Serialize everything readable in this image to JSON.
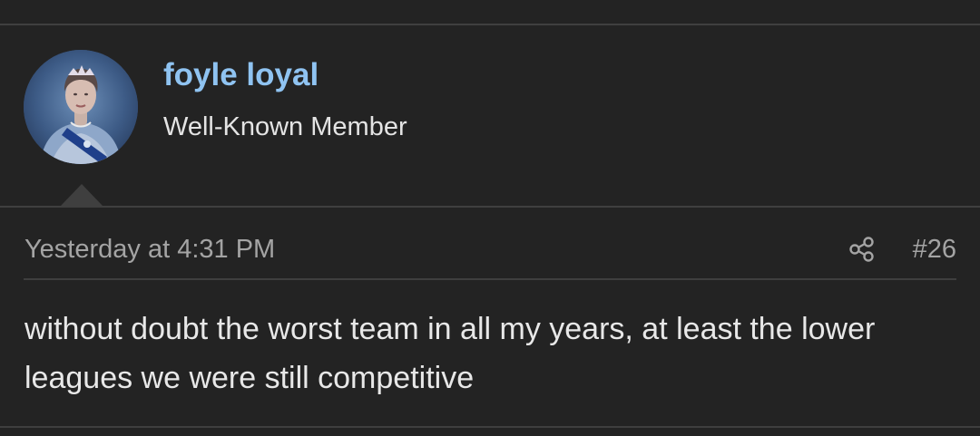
{
  "user": {
    "name": "foyle loyal",
    "title": "Well-Known Member"
  },
  "post": {
    "date": "Yesterday at 4:31 PM",
    "number": "#26",
    "body": "without doubt the worst team in all my years, at least the lower leagues we were still competitive"
  },
  "icons": {
    "share": "share-icon",
    "avatar": "user-avatar"
  },
  "colors": {
    "background": "#232323",
    "username": "#8fc3f1",
    "muted_text": "#a4a4a4",
    "body_text": "#e8e8e8",
    "divider": "#3f3f3f"
  }
}
